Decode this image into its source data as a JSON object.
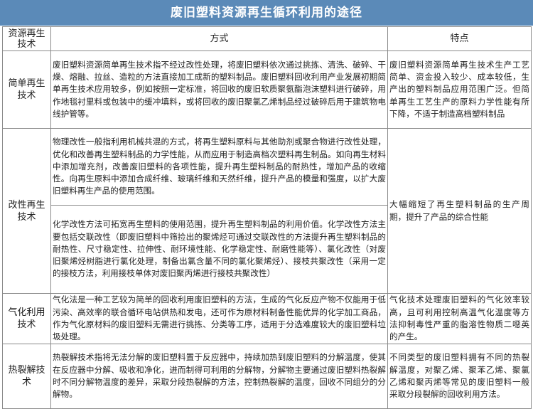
{
  "title": "废旧塑料资源再生循环利用的途径",
  "headers": {
    "col1": "资源再生技术",
    "col2": "方式",
    "col3": "特点"
  },
  "rows": {
    "simple": {
      "category": "简单再生技术",
      "method": "废旧塑料资源简单再生技术指不经过改性处理，将废旧塑料依次通过挑拣、清洗、破碎、干燥、熔融、拉丝、造粒的方法直接加工成新的塑料制品。废旧塑料回收利用产业发展初期简单再生技术应用较多，例如按照一定标准，将回收的废旧软质聚氨酯泡沫塑料进行破碎，用作地毯衬里料或包装中的缓冲填料，或将回收的废旧聚氯乙烯制品经过破碎后用于建筑物电线护管等。",
      "feature": "废旧塑料资源简单再生技术生产工艺简单、资金投入较少、成本较低，生产出的塑料制品应用范围广泛。但简单再生工艺生产的原料力学性能有所下降，不适于制造高档塑料制品"
    },
    "modified": {
      "category": "改性再生技术",
      "method_physical": "物理改性一般指利用机械共混的方式，将再生塑料原料与其他助剂或聚合物进行改性处理，优化和改善再生塑料制品的力学性能，从而应用于制造高档次塑料再生制品。如向再生材料中添加增充剂，改善废旧塑料的各项性能，提升再生塑料制品的耐热性，增加产品的收缩性。向再生原料中添加合成纤维、玻璃纤维和天然纤维，提升产品的模量和强度，以扩大废旧塑料再生产品的使用范围。",
      "method_chemical": "化学改性方法可拓宽再生塑料的使用范围，提升再生塑料制品的利用价值。化学改性方法主要包括交联改性（即废旧塑料中筛捡出的聚烯烃可通过交联改性的方法提升再生塑料制品的耐热性、尺寸稳定性、拉伸性、耐环境性能、化学稳定性、耐磨性能等）、氯化改性（对废旧聚烯烃树脂进行氯化处理，制备出氯含量不同的氯化聚烯烃）、接枝共聚改性（采用一定的接枝方法，利用接枝单体对废旧聚丙烯进行接枝共聚改性）",
      "feature": "大幅缩短了再生塑料制品的生产周期，提升了产品的综合性能"
    },
    "gasification": {
      "category": "气化利用技术",
      "method": "气化法是一种工艺较为简单的回收利用废旧塑料的方法，生成的气化反应产物不仅能用于低污染、高效率的联合循环电站供热和发电，还可作为原材料制备性能优异的化学加工商品，作为气化原材料的废旧塑料无需进行挑拣、分类等工序，适用于分选难度较大的废旧塑料垃圾处理。",
      "feature": "气化技术处理废旧塑料的气化效率较高，且可利用控制高温气化温度等方法抑制毒性严重的脂溶性物质二噁英的产生。"
    },
    "pyrolysis": {
      "category": "热裂解技术",
      "method": "热裂解技术指将无法分解的废旧塑料置于反应器中，持续加热到废旧塑料的分解温度，使其在反应器中分解、吸收和净化，进而制得可利用的分解物，分解物主要通过废旧塑料热裂解时不同分解物温度的差异，采取分段热裂解的方法，控制热裂解的温度，回收不同组分的分解物。",
      "feature": "不同类型的废旧塑料拥有不同的热裂解温度，对聚乙烯、聚苯乙烯、聚氯乙烯和聚丙烯等常见的废旧塑料一般采取分段裂解的回收利用方法。"
    }
  },
  "colors": {
    "title_bg": "#5b8ab8",
    "border": "#8a8a8a"
  }
}
